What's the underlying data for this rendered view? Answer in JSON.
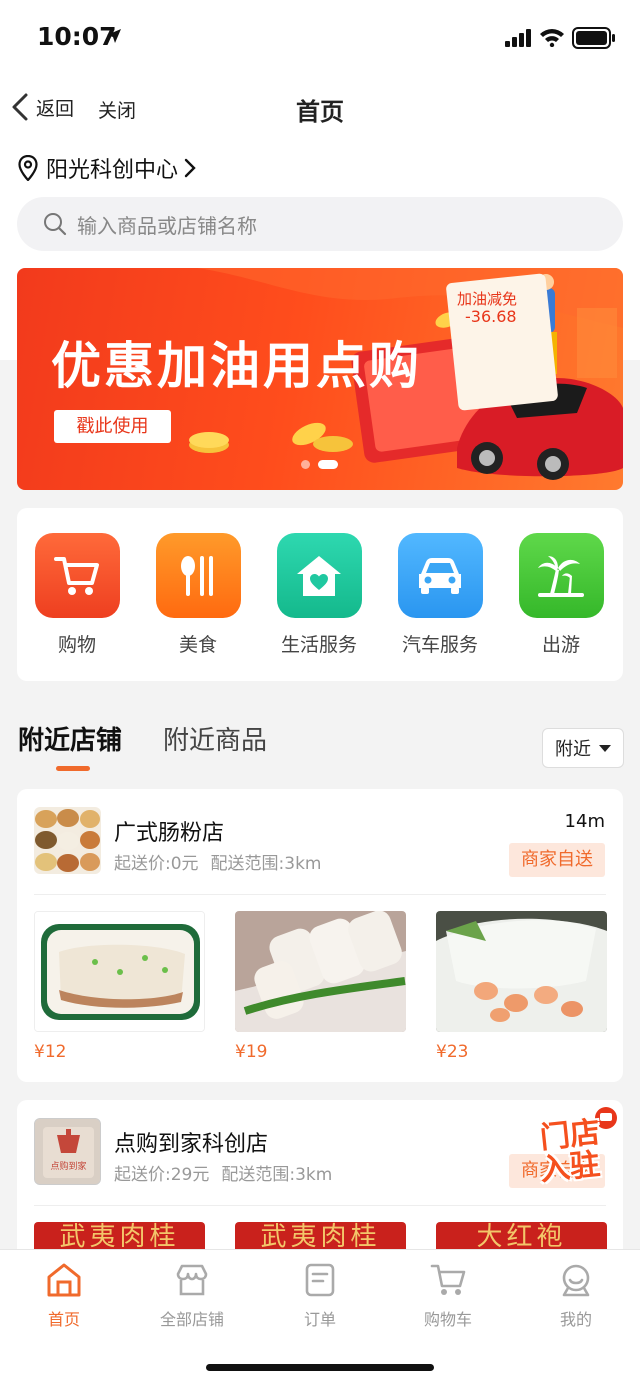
{
  "status": {
    "time": "10:07"
  },
  "nav": {
    "back_label": "返回",
    "close_label": "关闭",
    "title": "首页"
  },
  "location": {
    "name": "阳光科创中心"
  },
  "search": {
    "placeholder": "输入商品或店铺名称"
  },
  "banner": {
    "title": "优惠加油用点购",
    "button": "戳此使用",
    "receipt_label": "加油减免",
    "receipt_value": "-36.68",
    "page_dots": 2,
    "active_dot": 2
  },
  "categories": [
    {
      "label": "购物",
      "icon": "cart-icon",
      "color": "#f0522a"
    },
    {
      "label": "美食",
      "icon": "utensils-icon",
      "color": "#ff7b1a"
    },
    {
      "label": "生活服务",
      "icon": "home-heart-icon",
      "color": "#1fc8a0"
    },
    {
      "label": "汽车服务",
      "icon": "car-icon",
      "color": "#3aa6f5"
    },
    {
      "label": "出游",
      "icon": "palm-tree-icon",
      "color": "#4cc93b"
    }
  ],
  "tabs": {
    "active": "附近店铺",
    "inactive": "附近商品",
    "filter": "附近"
  },
  "stores": [
    {
      "name": "广式肠粉店",
      "min_order": "起送价:0元",
      "range": "配送范围:3km",
      "distance": "14m",
      "tag": "商家自送",
      "products": [
        {
          "price": "¥12"
        },
        {
          "price": "¥19"
        },
        {
          "price": "¥23"
        }
      ]
    },
    {
      "name": "点购到家科创店",
      "min_order": "起送价:29元",
      "range": "配送范围:3km",
      "tag": "商家自送",
      "logo_text": "点购到家",
      "product_banners": [
        "武夷肉桂",
        "武夷肉桂",
        "大红袍"
      ]
    }
  ],
  "float_badge": {
    "line1": "门店",
    "line2": "入驻"
  },
  "tabbar": [
    {
      "label": "首页",
      "icon": "home-icon",
      "active": true
    },
    {
      "label": "全部店铺",
      "icon": "store-icon",
      "active": false
    },
    {
      "label": "订单",
      "icon": "order-icon",
      "active": false
    },
    {
      "label": "购物车",
      "icon": "cart-icon",
      "active": false
    },
    {
      "label": "我的",
      "icon": "profile-icon",
      "active": false
    }
  ],
  "colors": {
    "accent": "#f06a2c",
    "banner": "#f23a1c",
    "tag_bg": "#fde7dc"
  }
}
